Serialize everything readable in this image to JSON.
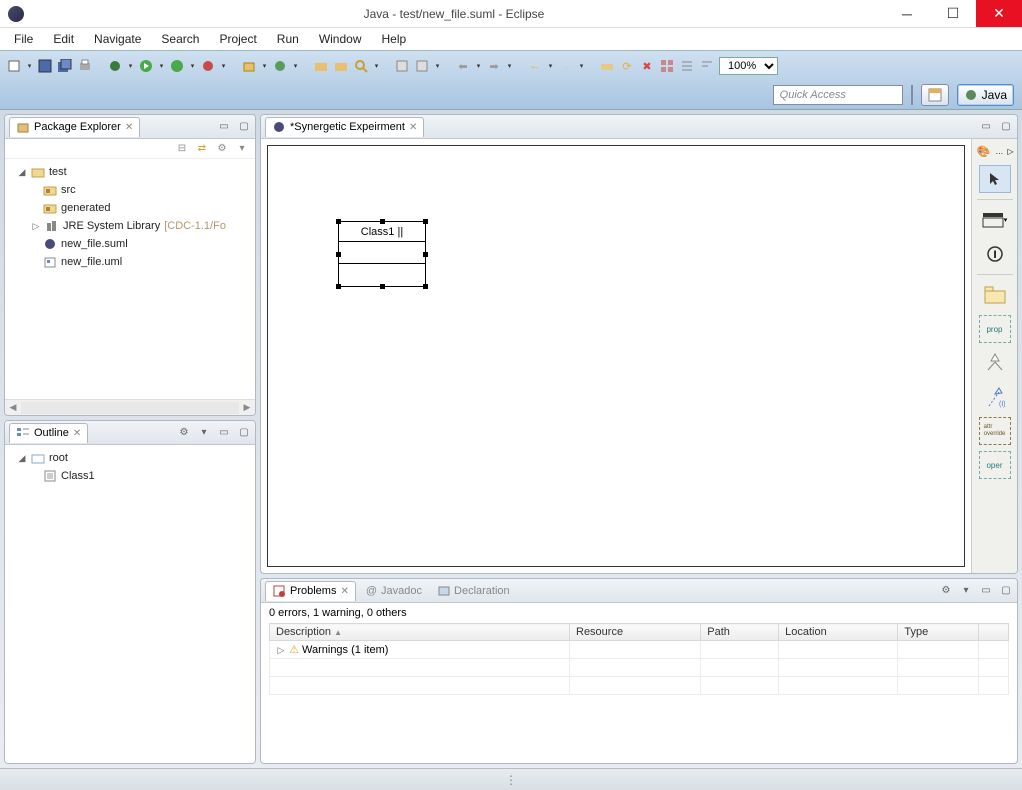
{
  "window": {
    "title": "Java - test/new_file.suml - Eclipse"
  },
  "menu": [
    "File",
    "Edit",
    "Navigate",
    "Search",
    "Project",
    "Run",
    "Window",
    "Help"
  ],
  "toolbar": {
    "zoom": "100%",
    "quick_access_placeholder": "Quick Access",
    "perspective_label": "Java"
  },
  "package_explorer": {
    "tab_label": "Package Explorer",
    "items": {
      "project": "test",
      "src": "src",
      "generated": "generated",
      "jre": "JRE System Library",
      "jre_suffix": "[CDC-1.1/Fo",
      "file1": "new_file.suml",
      "file2": "new_file.uml"
    }
  },
  "outline": {
    "tab_label": "Outline",
    "root": "root",
    "class1": "Class1"
  },
  "editor": {
    "tab_label": "*Synergetic Expeirment",
    "class_name": "Class1 ||"
  },
  "palette": {
    "prop": "prop",
    "attr": "attr\noverride",
    "oper": "oper"
  },
  "problems": {
    "tab_problems": "Problems",
    "tab_javadoc": "Javadoc",
    "tab_declaration": "Declaration",
    "summary": "0 errors, 1 warning, 0 others",
    "cols": {
      "description": "Description",
      "resource": "Resource",
      "path": "Path",
      "location": "Location",
      "type": "Type"
    },
    "warning_row": "Warnings (1 item)"
  }
}
